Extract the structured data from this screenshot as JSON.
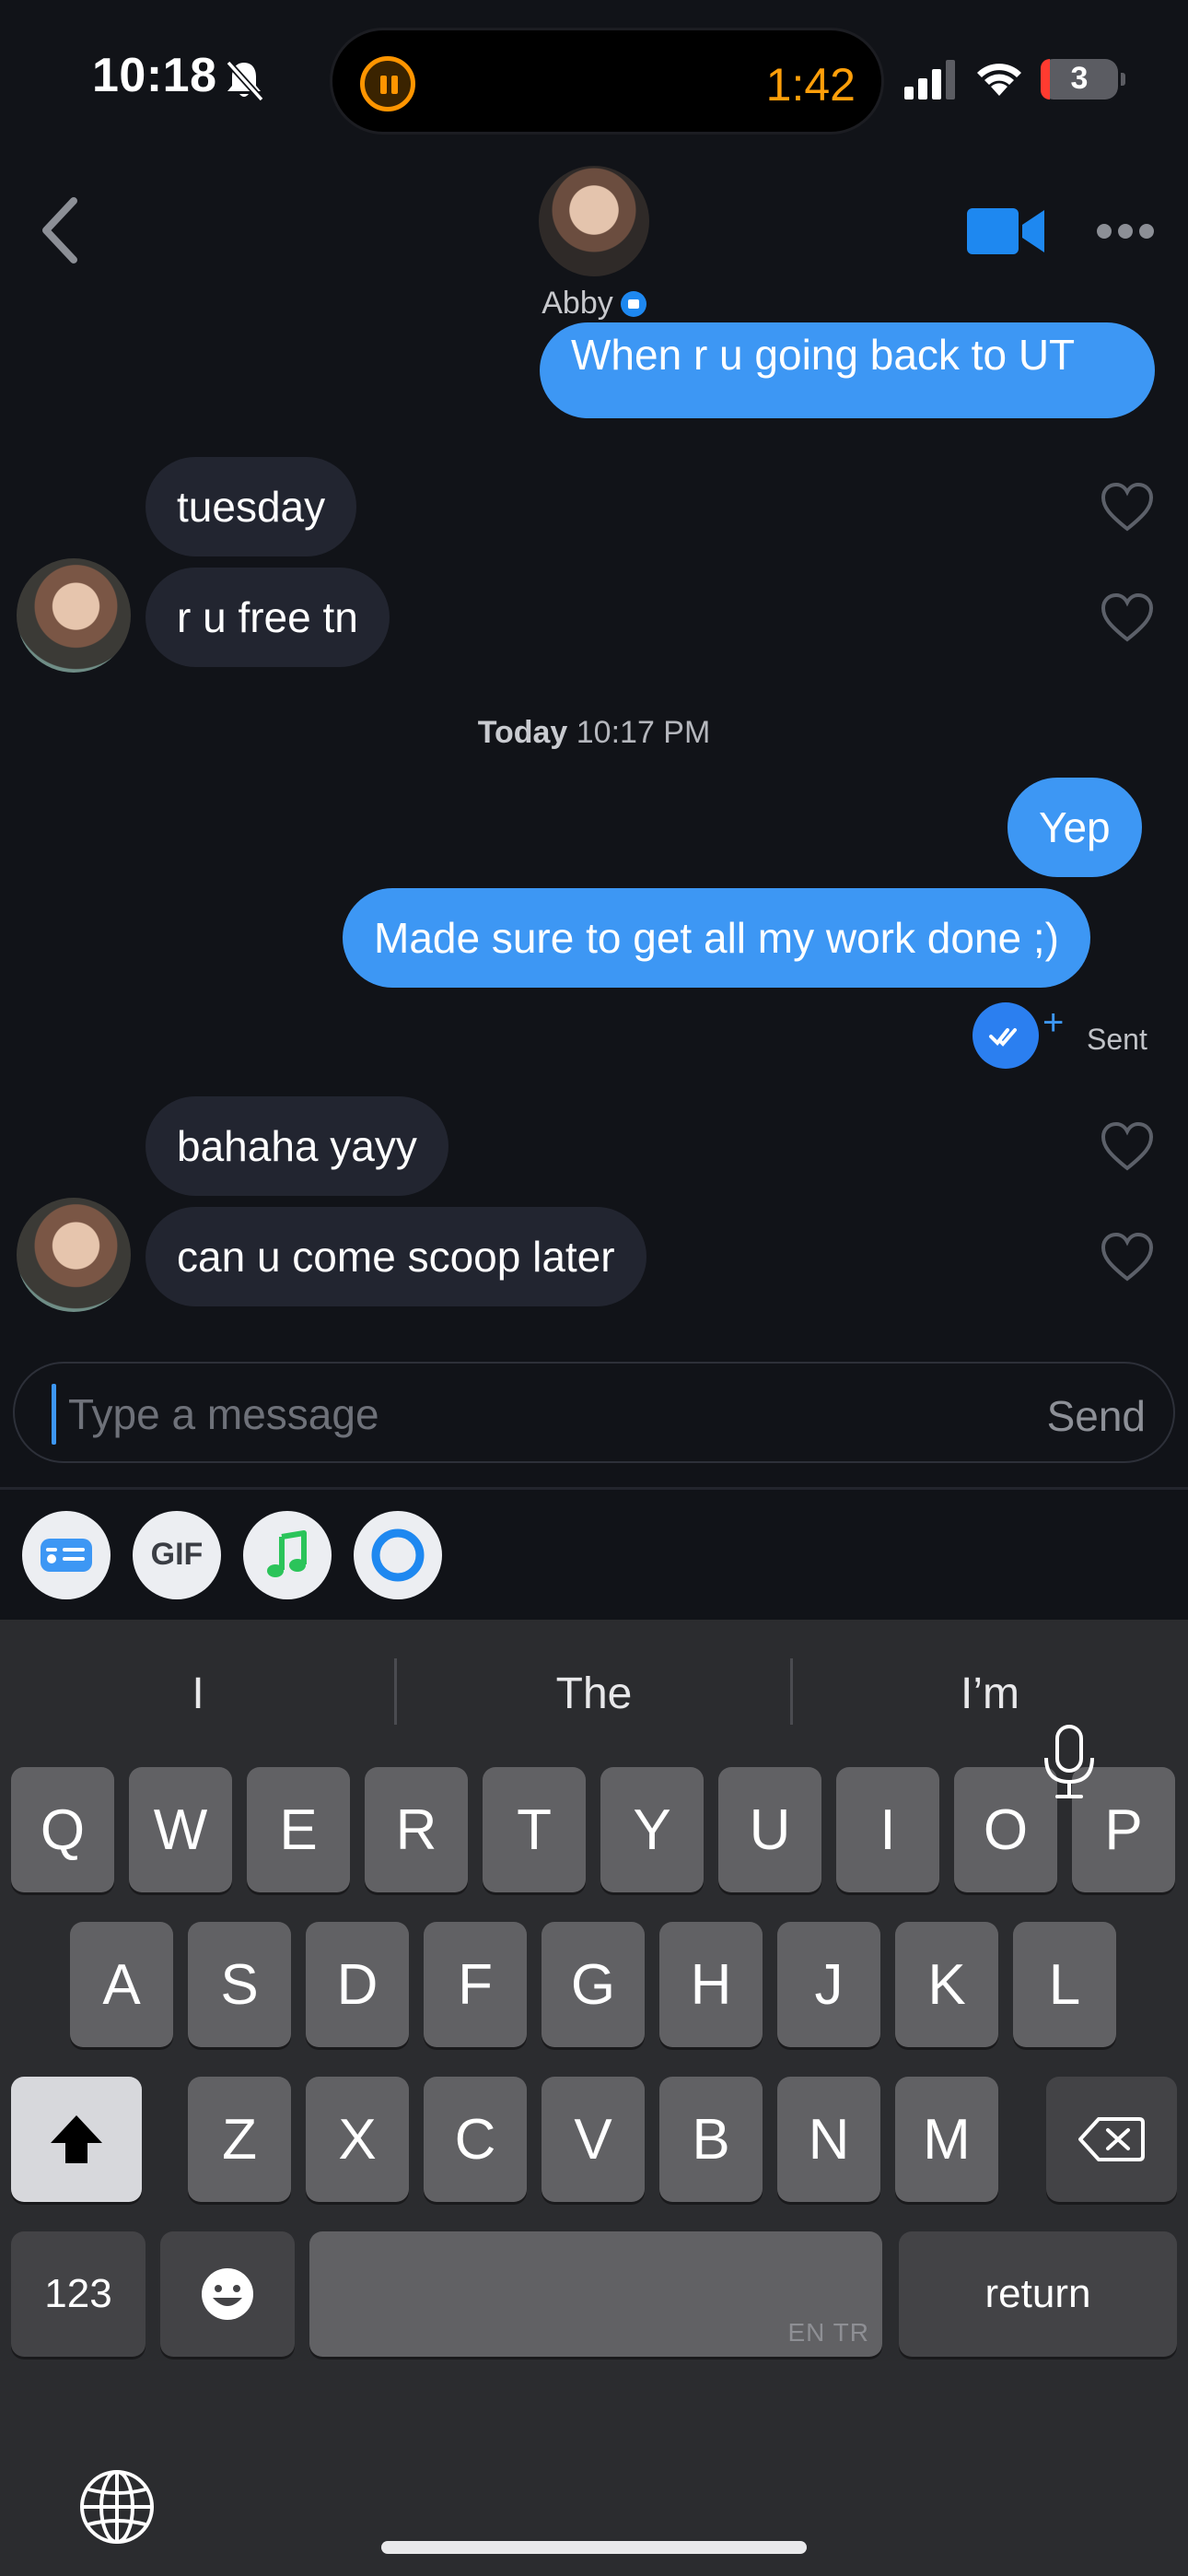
{
  "status_bar": {
    "time": "10:18",
    "island_timer": "1:42",
    "battery_level": "3"
  },
  "header": {
    "contact_name": "Abby"
  },
  "messages": [
    {
      "dir": "out",
      "text": "When r u going back to UT"
    },
    {
      "dir": "in",
      "text": "tuesday"
    },
    {
      "dir": "in",
      "text": "r u free tn"
    },
    {
      "dir": "out",
      "text": "Yep"
    },
    {
      "dir": "out",
      "text": "Made sure to get all my work done ;)"
    },
    {
      "dir": "in",
      "text": "bahaha yayy"
    },
    {
      "dir": "in",
      "text": "can u come scoop later"
    }
  ],
  "timestamp": {
    "day": "Today",
    "time": "10:17 PM"
  },
  "receipt": {
    "status": "Sent",
    "plus": "+"
  },
  "composer": {
    "placeholder": "Type a message",
    "send_label": "Send"
  },
  "attachments": {
    "gif_label": "GIF"
  },
  "keyboard": {
    "suggestions": [
      "I",
      "The",
      "I’m"
    ],
    "row1": [
      "Q",
      "W",
      "E",
      "R",
      "T",
      "Y",
      "U",
      "I",
      "O",
      "P"
    ],
    "row2": [
      "A",
      "S",
      "D",
      "F",
      "G",
      "H",
      "J",
      "K",
      "L"
    ],
    "row3": [
      "Z",
      "X",
      "C",
      "V",
      "B",
      "N",
      "M"
    ],
    "numbers_label": "123",
    "return_label": "return",
    "space_hint": "EN TR"
  },
  "colors": {
    "outgoing_bubble": "#3d97f4",
    "incoming_bubble": "#222530",
    "accent": "#1e88f0",
    "timer": "#ff9f0a"
  },
  "icons": [
    "bell-slash-icon",
    "pause-icon",
    "signal-icon",
    "wifi-icon",
    "battery-icon",
    "back-chevron-icon",
    "video-camera-icon",
    "more-icon",
    "heart-icon",
    "double-check-icon",
    "id-card-icon",
    "music-note-icon",
    "ring-icon",
    "shift-icon",
    "delete-icon",
    "emoji-icon",
    "globe-icon",
    "microphone-icon"
  ]
}
